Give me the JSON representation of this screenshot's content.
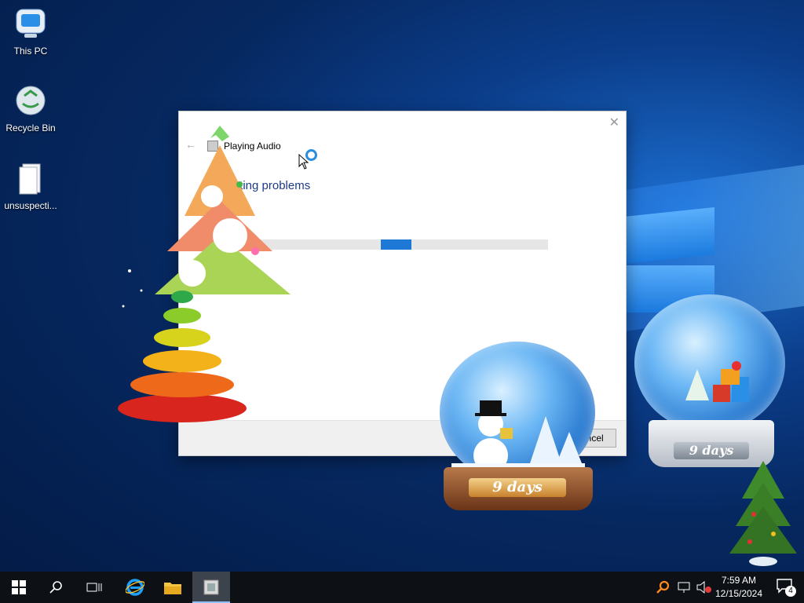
{
  "desktop": {
    "icons": [
      {
        "label": "This PC",
        "icon": "computer-icon"
      },
      {
        "label": "Recycle Bin",
        "icon": "recycle-bin-icon"
      },
      {
        "label": "unsuspecti...",
        "icon": "file-icon"
      }
    ]
  },
  "dialog": {
    "app_title": "Playing Audio",
    "heading": "Detecting problems",
    "cancel_label": "Cancel",
    "close_icon": "close-icon",
    "back_icon": "back-arrow-icon"
  },
  "decorations": {
    "globe_center_label": "9 days",
    "globe_right_label": "9 days"
  },
  "taskbar": {
    "buttons": [
      "start-icon",
      "search-icon",
      "task-view-icon",
      "internet-explorer-icon",
      "file-explorer-icon",
      "troubleshooter-icon"
    ],
    "clock_time": "7:59 AM",
    "clock_date": "12/15/2024",
    "notification_count": "4"
  },
  "colors": {
    "accent": "#1e78d6",
    "heading": "#1b3a8a",
    "taskbar": "#0d1116"
  }
}
